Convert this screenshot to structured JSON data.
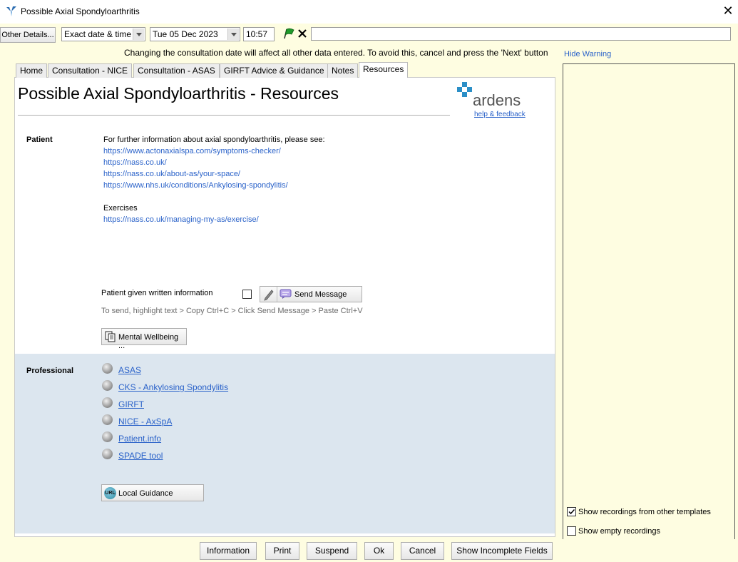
{
  "window": {
    "title": "Possible Axial Spondyloarthritis",
    "close_glyph": "✕"
  },
  "toolbar": {
    "other_details": "Other Details...",
    "date_mode": "Exact date & time",
    "date": "Tue 05 Dec 2023",
    "time": "10:57",
    "free_text": ""
  },
  "warning": {
    "text": "Changing the consultation date will affect all other data entered. To avoid this, cancel and press the 'Next' button",
    "hide": "Hide Warning"
  },
  "tabs": [
    "Home",
    "Consultation - NICE",
    "Consultation - ASAS",
    "GIRFT Advice & Guidance",
    "Notes",
    "Resources"
  ],
  "active_tab": "Resources",
  "page": {
    "title": "Possible Axial Spondyloarthritis - Resources",
    "logo_text": "ardens",
    "help": "help & feedback"
  },
  "patient": {
    "label": "Patient",
    "intro": "For further information about axial spondyloarthritis, please see:",
    "links": [
      "https://www.actonaxialspa.com/symptoms-checker/",
      "https://nass.co.uk/",
      "https://nass.co.uk/about-as/your-space/",
      "https://www.nhs.uk/conditions/Ankylosing-spondylitis/"
    ],
    "exercises_label": "Exercises",
    "exercise_link": "https://nass.co.uk/managing-my-as/exercise/",
    "given_info": "Patient given written information",
    "send_message": "Send Message",
    "send_hint": "To send, highlight text > Copy Ctrl+C > Click Send Message > Paste Ctrl+V",
    "wellbeing": "Mental Wellbeing ..."
  },
  "professional": {
    "label": "Professional",
    "links": [
      "ASAS",
      "CKS - Ankylosing Spondylitis",
      "GIRFT",
      "NICE - AxSpA",
      "Patient.info",
      "SPADE tool"
    ],
    "local_guidance": "Local Guidance",
    "url_badge": "URL"
  },
  "side": {
    "show_other": "Show recordings from other templates",
    "show_other_checked": true,
    "show_empty": "Show empty recordings",
    "show_empty_checked": false
  },
  "buttons": {
    "information": "Information",
    "print": "Print",
    "suspend": "Suspend",
    "ok": "Ok",
    "cancel": "Cancel",
    "show_incomplete": "Show Incomplete Fields"
  },
  "colors": {
    "link": "#2a62c9",
    "background": "#fefde1",
    "professional_bg": "#dce6ef",
    "logo_teal": "#2b8fc7"
  }
}
